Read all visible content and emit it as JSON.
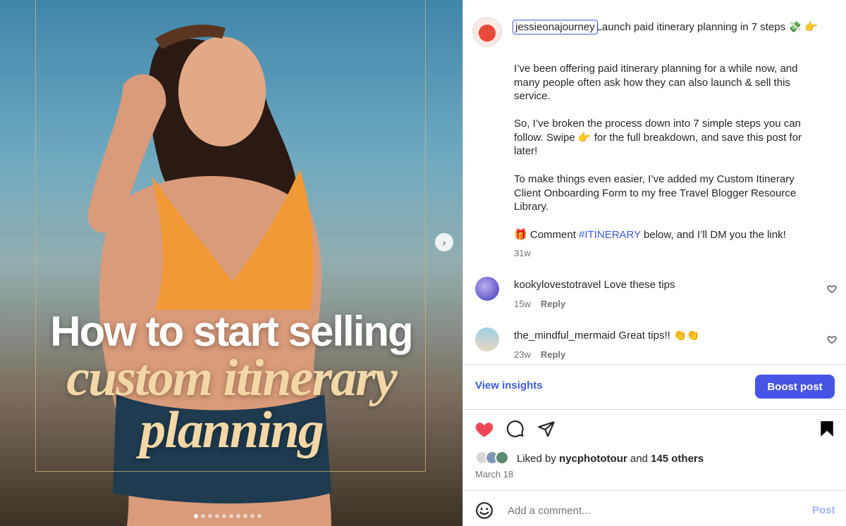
{
  "media": {
    "headline_line1": "How to start selling",
    "headline_line2": "custom itinerary",
    "headline_line3": "planning",
    "slide_count": 10,
    "active_slide": 1,
    "next_icon": "chevron-right-icon"
  },
  "caption": {
    "username": "jessieonajourney",
    "title": "Launch paid itinerary planning in 7 steps 💸 👉",
    "para1": "I’ve been offering paid itinerary planning for a while now, and many people often ask how they can also launch & sell this service.",
    "para2": "So, I’ve broken the process down into 7 simple steps you can follow. Swipe 👉 for the full breakdown, and save this post for later!",
    "para3": "To make things even easier, I’ve added my Custom Itinerary Client Onboarding Form to my free Travel Blogger Resource Library.",
    "para4_prefix": "🎁 Comment ",
    "para4_hashtag": "#ITINERARY",
    "para4_suffix": " below, and I’ll DM you the link!",
    "time": "31w"
  },
  "comments": [
    {
      "username": "kookylovestotravel",
      "text": "Love these tips",
      "time": "15w",
      "reply": "Reply"
    },
    {
      "username": "the_mindful_mermaid",
      "text": "Great tips!! 👏👏",
      "time": "23w",
      "reply": "Reply"
    }
  ],
  "actions": {
    "insights": "View insights",
    "boost": "Boost post",
    "liked_prefix": "Liked by ",
    "liked_user": "nycphototour",
    "liked_and": " and ",
    "liked_others": "145 others",
    "date": "March 18",
    "comment_placeholder": "Add a comment...",
    "post": "Post"
  },
  "colors": {
    "accent": "#3d5bd6",
    "boost_bg": "#4755e6",
    "like_red": "#ed4956",
    "headline_gold": "#f3d7a6"
  }
}
